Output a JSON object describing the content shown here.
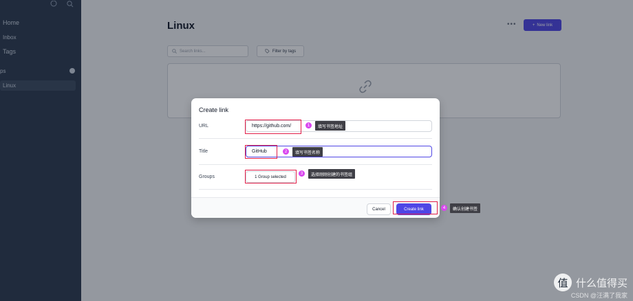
{
  "sidebar": {
    "items": [
      {
        "label": "Home"
      },
      {
        "label": "Inbox"
      },
      {
        "label": "Tags"
      },
      {
        "label": "ps"
      },
      {
        "label": "Linux"
      }
    ]
  },
  "main": {
    "title": "Linux",
    "more_label": "•••",
    "new_link_label": "New link",
    "search_placeholder": "Search links...",
    "filter_label": "Filter by tags"
  },
  "dialog": {
    "title": "Create link",
    "url_label": "URL",
    "url_value": "https://github.com/",
    "title_label": "Title",
    "title_value": "GitHub",
    "groups_label": "Groups",
    "groups_value": "1 Group selected",
    "cancel_label": "Cancel",
    "create_label": "Create link"
  },
  "annotations": [
    {
      "num": "1",
      "text": "填写书签地址"
    },
    {
      "num": "2",
      "text": "填写书签名称"
    },
    {
      "num": "3",
      "text": "选择刚刚创建的书签组"
    },
    {
      "num": "4",
      "text": "确认创建书签"
    }
  ],
  "watermark": {
    "text": "什么值得买",
    "sub": "CSDN @汪满了我家"
  },
  "colors": {
    "accent": "#4f46e5",
    "sidebar": "#2c3a4f",
    "annotation_box": "#e11d48",
    "annotation_num": "#d946ef"
  }
}
